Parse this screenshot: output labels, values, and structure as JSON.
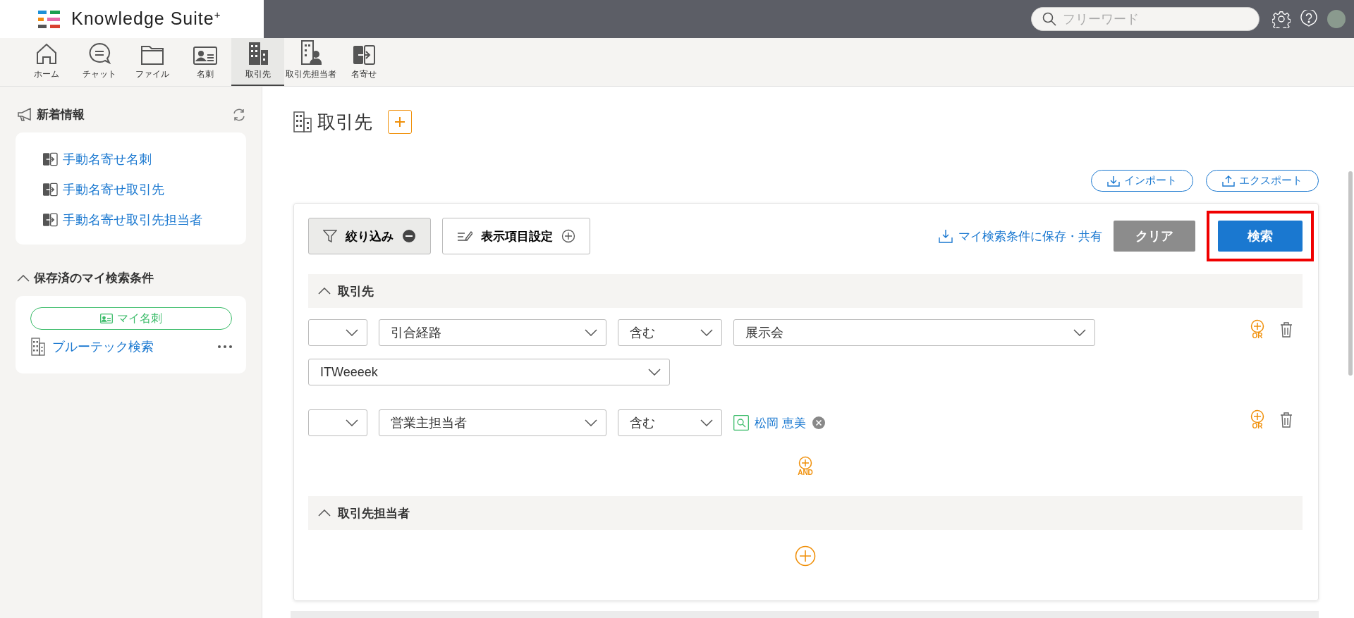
{
  "header": {
    "logo": "Knowledge Suite$^{+}$",
    "search": {
      "placeholder": "フリーワード"
    }
  },
  "nav": [
    {
      "label": "ホーム",
      "kind": "home",
      "selected": false
    },
    {
      "label": "チャット",
      "kind": "chat",
      "selected": false
    },
    {
      "label": "ファイル",
      "kind": "folder",
      "selected": false
    },
    {
      "label": "名刺",
      "kind": "card",
      "selected": false
    },
    {
      "label": "取引先",
      "kind": "building",
      "selected": true
    },
    {
      "label": "取引先担当者",
      "kind": "contact",
      "selected": false
    },
    {
      "label": "名寄せ",
      "kind": "merge",
      "selected": false
    }
  ],
  "sidebar": {
    "news": {
      "title": "新着情報",
      "items": [
        "手動名寄せ名刺",
        "手動名寄せ取引先",
        "手動名寄せ取引先担当者"
      ]
    },
    "saved": {
      "title": "保存済のマイ検索条件",
      "expanded": true,
      "tag": "マイ名刺",
      "items": [
        "ブルーテック検索"
      ]
    }
  },
  "page": {
    "title": "取引先",
    "actions": [
      {
        "label": "インポート",
        "kind": "import"
      },
      {
        "label": "エクスポート",
        "kind": "export"
      }
    ]
  },
  "filter": {
    "toolbar": {
      "filter_button": {
        "label": "絞り込み",
        "active": true
      },
      "columns_button": "表示項目設定",
      "save_link": "マイ検索条件に保存・共有",
      "clear": "クリア",
      "search": {
        "label": "検索",
        "highlighted": true
      }
    },
    "sections": [
      {
        "title": "取引先",
        "expanded": true,
        "and_label": "AND",
        "conditions": [
          {
            "kind": "select",
            "field": "引合経路",
            "operator": "含む",
            "values": [
              "展示会",
              "ITWeeeek"
            ],
            "or_label": "OR"
          },
          {
            "kind": "person",
            "field": "営業主担当者",
            "operator": "含む",
            "person": "松岡 恵美",
            "or_label": "OR"
          }
        ]
      },
      {
        "title": "取引先担当者",
        "expanded": true
      }
    ]
  }
}
